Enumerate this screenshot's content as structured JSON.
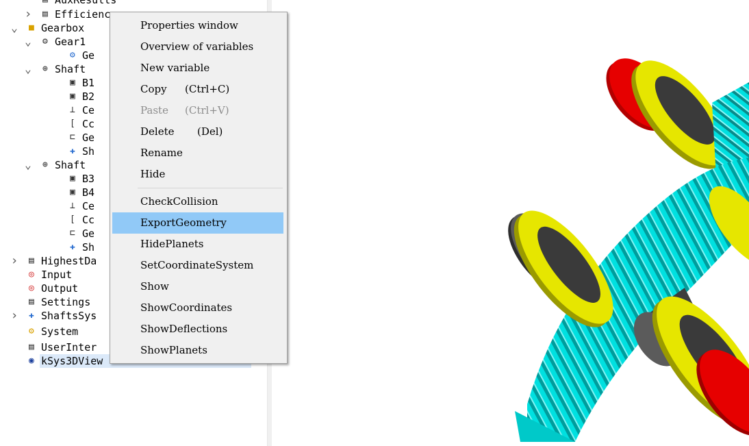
{
  "tree": {
    "items": [
      {
        "label": "AuxResults",
        "icon": "table-icon"
      },
      {
        "label": "Efficienc",
        "icon": "document-icon",
        "expander": "chevron-right"
      },
      {
        "label": "Gearbox",
        "icon": "folder-icon",
        "expander": "chevron-down"
      },
      {
        "label": "Gear1",
        "icon": "gear-pair-icon",
        "expander": "chevron-down"
      },
      {
        "label": "Ge",
        "icon": "gears-icon"
      },
      {
        "label": "Shaft",
        "icon": "shaft-icon",
        "expander": "chevron-down"
      },
      {
        "label": "B1",
        "icon": "bearing-icon"
      },
      {
        "label": "B2",
        "icon": "bearing-icon"
      },
      {
        "label": "Ce",
        "icon": "force-icon"
      },
      {
        "label": "Cc",
        "icon": "coupling-icon"
      },
      {
        "label": "Ge",
        "icon": "gear-icon"
      },
      {
        "label": "Sh",
        "icon": "shaft-segment-icon"
      },
      {
        "label": "Shaft",
        "icon": "shaft-icon",
        "expander": "chevron-down"
      },
      {
        "label": "B3",
        "icon": "bearing-icon"
      },
      {
        "label": "B4",
        "icon": "bearing-icon"
      },
      {
        "label": "Ce",
        "icon": "force-icon"
      },
      {
        "label": "Cc",
        "icon": "coupling-icon"
      },
      {
        "label": "Ge",
        "icon": "gear-icon"
      },
      {
        "label": "Sh",
        "icon": "shaft-segment-icon"
      },
      {
        "label": "HighestDa",
        "icon": "table-icon",
        "expander": "chevron-right"
      },
      {
        "label": "Input",
        "icon": "target-icon"
      },
      {
        "label": "Output",
        "icon": "target-icon"
      },
      {
        "label": "Settings",
        "icon": "table-icon"
      },
      {
        "label": "ShaftsSys",
        "icon": "shafts-system-icon",
        "expander": "chevron-right"
      },
      {
        "label": "System",
        "icon": "system-icon"
      },
      {
        "label": "UserInter",
        "icon": "table-icon"
      },
      {
        "label": "kSys3DView",
        "icon": "3d-view-icon",
        "selected": true
      }
    ]
  },
  "context_menu": {
    "items": [
      {
        "label": "Properties window"
      },
      {
        "label": "Overview of variables"
      },
      {
        "label": "New variable"
      },
      {
        "label": "Copy",
        "shortcut": "(Ctrl+C)"
      },
      {
        "label": "Paste",
        "shortcut": "(Ctrl+V)",
        "disabled": true
      },
      {
        "label": "Delete",
        "shortcut": "(Del)"
      },
      {
        "label": "Rename"
      },
      {
        "label": "Hide"
      },
      {
        "label": "CheckCollision"
      },
      {
        "label": "ExportGeometry",
        "highlighted": true
      },
      {
        "label": "HidePlanets"
      },
      {
        "label": "SetCoordinateSystem"
      },
      {
        "label": "Show"
      },
      {
        "label": "ShowCoordinates"
      },
      {
        "label": "ShowDeflections"
      },
      {
        "label": "ShowPlanets"
      }
    ]
  },
  "colors": {
    "gear": "#00e5e5",
    "bearing_outer": "#e6e600",
    "ring": "#e60000",
    "shaft": "#404040",
    "menu_highlight": "#91c9f7",
    "selection": "#dbe9f9"
  }
}
